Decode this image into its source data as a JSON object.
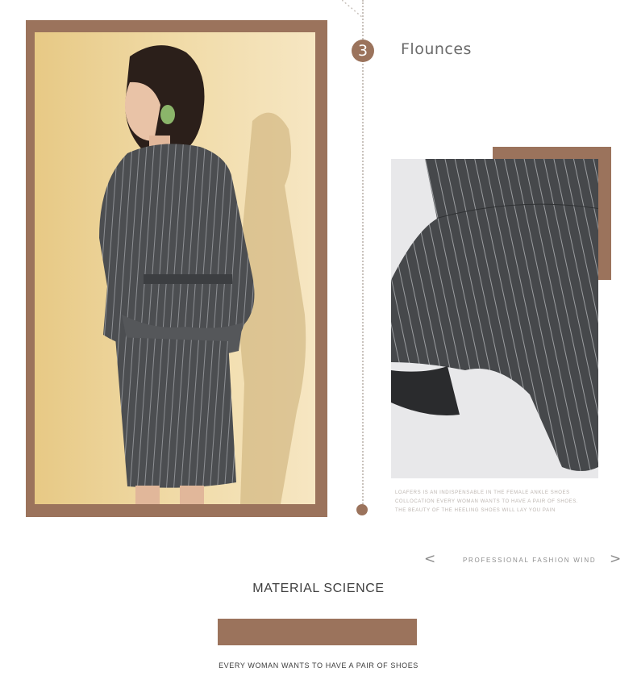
{
  "feature": {
    "step_number": "3",
    "title": "Flounces",
    "caption": "LOAFERS IS AN INDISPENSABLE IN THE FEMALE ANKLE SHOES COLLOCATION EVERY WOMAN WANTS TO HAVE A PAIR OF SHOES. THE BEAUTY OF THE HEELING SHOES WILL LAY YOU PAIN"
  },
  "slider": {
    "prev_icon": "chevron-left-icon",
    "next_icon": "chevron-right-icon",
    "prev_glyph": "<",
    "next_glyph": ">",
    "label": "PROFESSIONAL FASHION WIND"
  },
  "section": {
    "title": "MATERIAL SCIENCE",
    "tagline": "EVERY WOMAN WANTS TO HAVE A PAIR OF SHOES"
  },
  "colors": {
    "accent": "#9b735c",
    "photo_background": "#efd7a2",
    "fabric": "#4a4c4f"
  }
}
